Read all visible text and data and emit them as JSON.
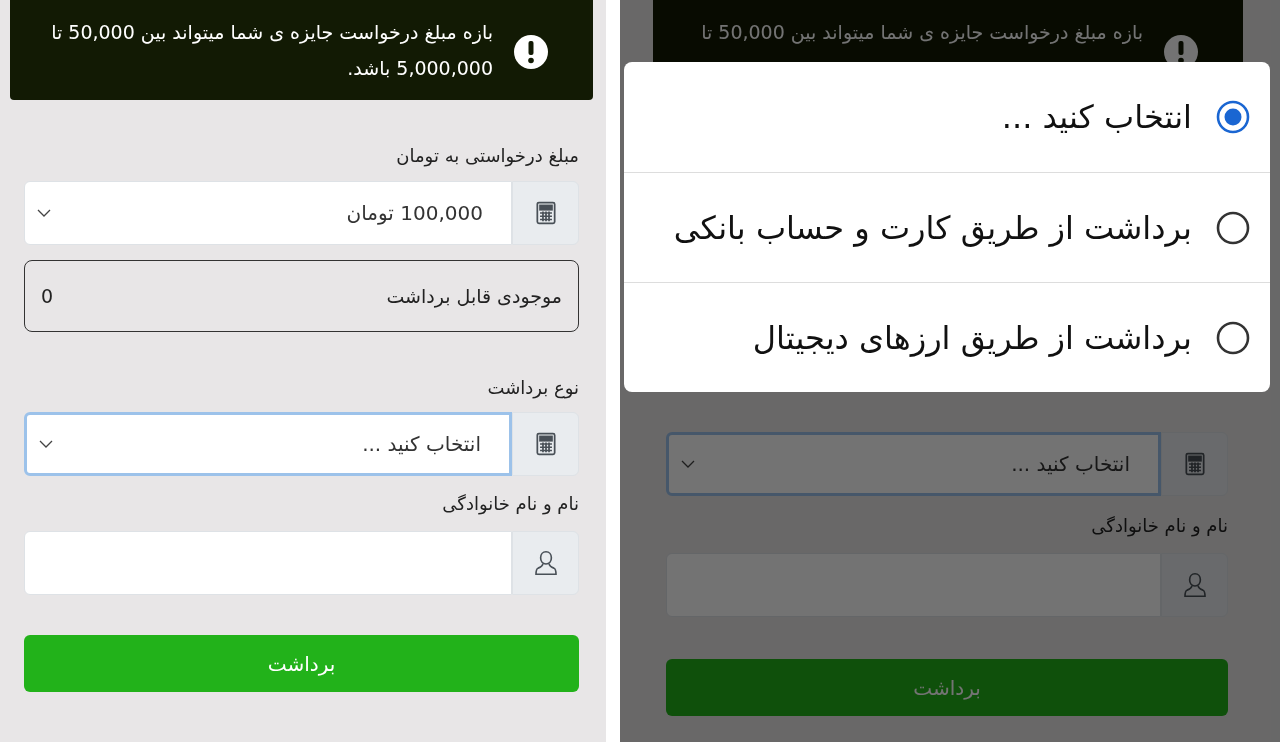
{
  "left_screen": {
    "alert": {
      "text": "بازه مبلغ درخواست جایزه ی شما میتواند بین 50,000 تا 5,000,000 باشد."
    },
    "amount_label": "مبلغ درخواستی به تومان",
    "amount_select": {
      "value": "100,000 تومان",
      "focused": false
    },
    "balance": {
      "label": "موجودی قابل برداشت",
      "value": "0"
    },
    "withdraw_type_label": "نوع برداشت",
    "withdraw_type_select": {
      "value": "انتخاب کنید ...",
      "focused": true
    },
    "name_label": "نام و نام خانوادگی",
    "submit_button": "برداشت"
  },
  "right_screen": {
    "alert": {
      "text": "بازه مبلغ درخواست جایزه ی شما میتواند بین 50,000 تا"
    },
    "withdraw_type_select": {
      "value": "انتخاب کنید ...",
      "focused": true
    },
    "name_label": "نام و نام خانوادگی",
    "submit_button": "برداشت",
    "dialog": {
      "options": [
        {
          "label": "انتخاب کنید ...",
          "selected": true
        },
        {
          "label": "برداشت از طریق کارت و حساب بانکی",
          "selected": false
        },
        {
          "label": "برداشت از طریق ارزهای دیجیتال",
          "selected": false
        }
      ]
    }
  }
}
